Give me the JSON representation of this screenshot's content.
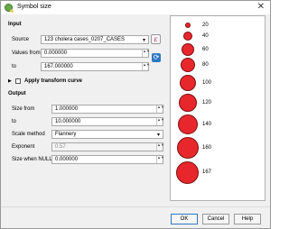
{
  "window": {
    "title": "Symbol size",
    "close_glyph": "✕"
  },
  "input": {
    "heading": "Input",
    "source_label": "Source",
    "source_value": "123 cholera cases_0207_CASES",
    "values_from_label": "Values from",
    "values_from_value": "0.000000",
    "to_label": "to",
    "to_value": "167.000000",
    "transform_label": "Apply transform curve"
  },
  "output": {
    "heading": "Output",
    "size_from_label": "Size from",
    "size_from_value": "1.000000",
    "to_label": "to",
    "to_value": "10.000000",
    "scale_method_label": "Scale method",
    "scale_method_value": "Flannery",
    "exponent_label": "Exponent",
    "exponent_value": "0.57",
    "null_label": "Size when NULL",
    "null_value": "0.000000"
  },
  "legend": {
    "symbol_color": "#e8272d",
    "items": [
      "20",
      "40",
      "60",
      "80",
      "100",
      "120",
      "140",
      "160",
      "167"
    ]
  },
  "buttons": {
    "ok": "OK",
    "cancel": "Cancel",
    "help": "Help"
  },
  "icons": {
    "expression": "ε",
    "refresh": "⟳",
    "dropdown": "▾",
    "spin": "▲▼",
    "collapse": "▶"
  }
}
